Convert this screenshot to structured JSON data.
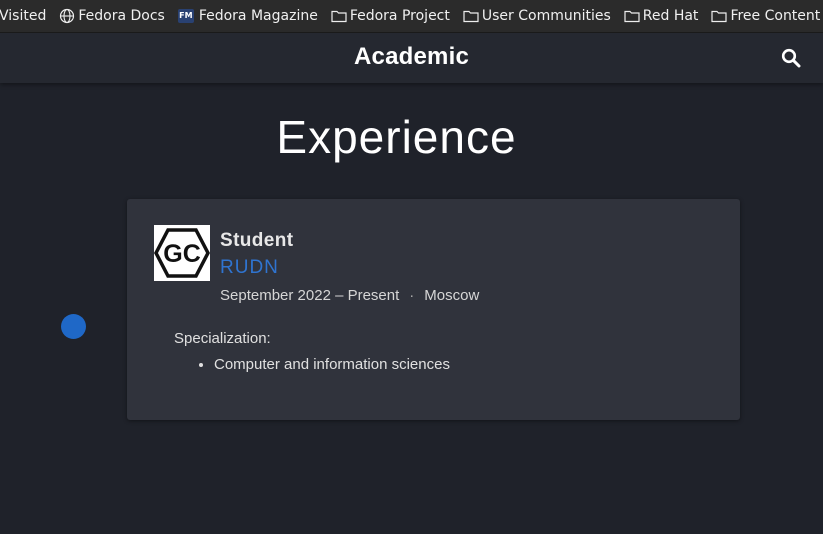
{
  "bookmarks": [
    {
      "label": "Visited",
      "icon": "none"
    },
    {
      "label": "Fedora Docs",
      "icon": "globe-icon"
    },
    {
      "label": "Fedora Magazine",
      "icon": "fedora-magazine-icon",
      "icon_text": "FM"
    },
    {
      "label": "Fedora Project",
      "icon": "folder-icon"
    },
    {
      "label": "User Communities",
      "icon": "folder-icon"
    },
    {
      "label": "Red Hat",
      "icon": "folder-icon"
    },
    {
      "label": "Free Content",
      "icon": "folder-icon"
    }
  ],
  "header": {
    "site_title": "Academic",
    "search_icon": "search-icon"
  },
  "section": {
    "title": "Experience"
  },
  "experience": {
    "logo_text": "GC",
    "role": "Student",
    "organization": "RUDN",
    "dates": "September 2022 – Present",
    "separator": "·",
    "location": "Moscow",
    "description_label": "Specialization:",
    "description_items": [
      "Computer and information sciences"
    ]
  },
  "colors": {
    "background": "#1f222a",
    "card": "#30333c",
    "accent": "#2f74d0",
    "timeline_dot": "#1f68c7"
  }
}
